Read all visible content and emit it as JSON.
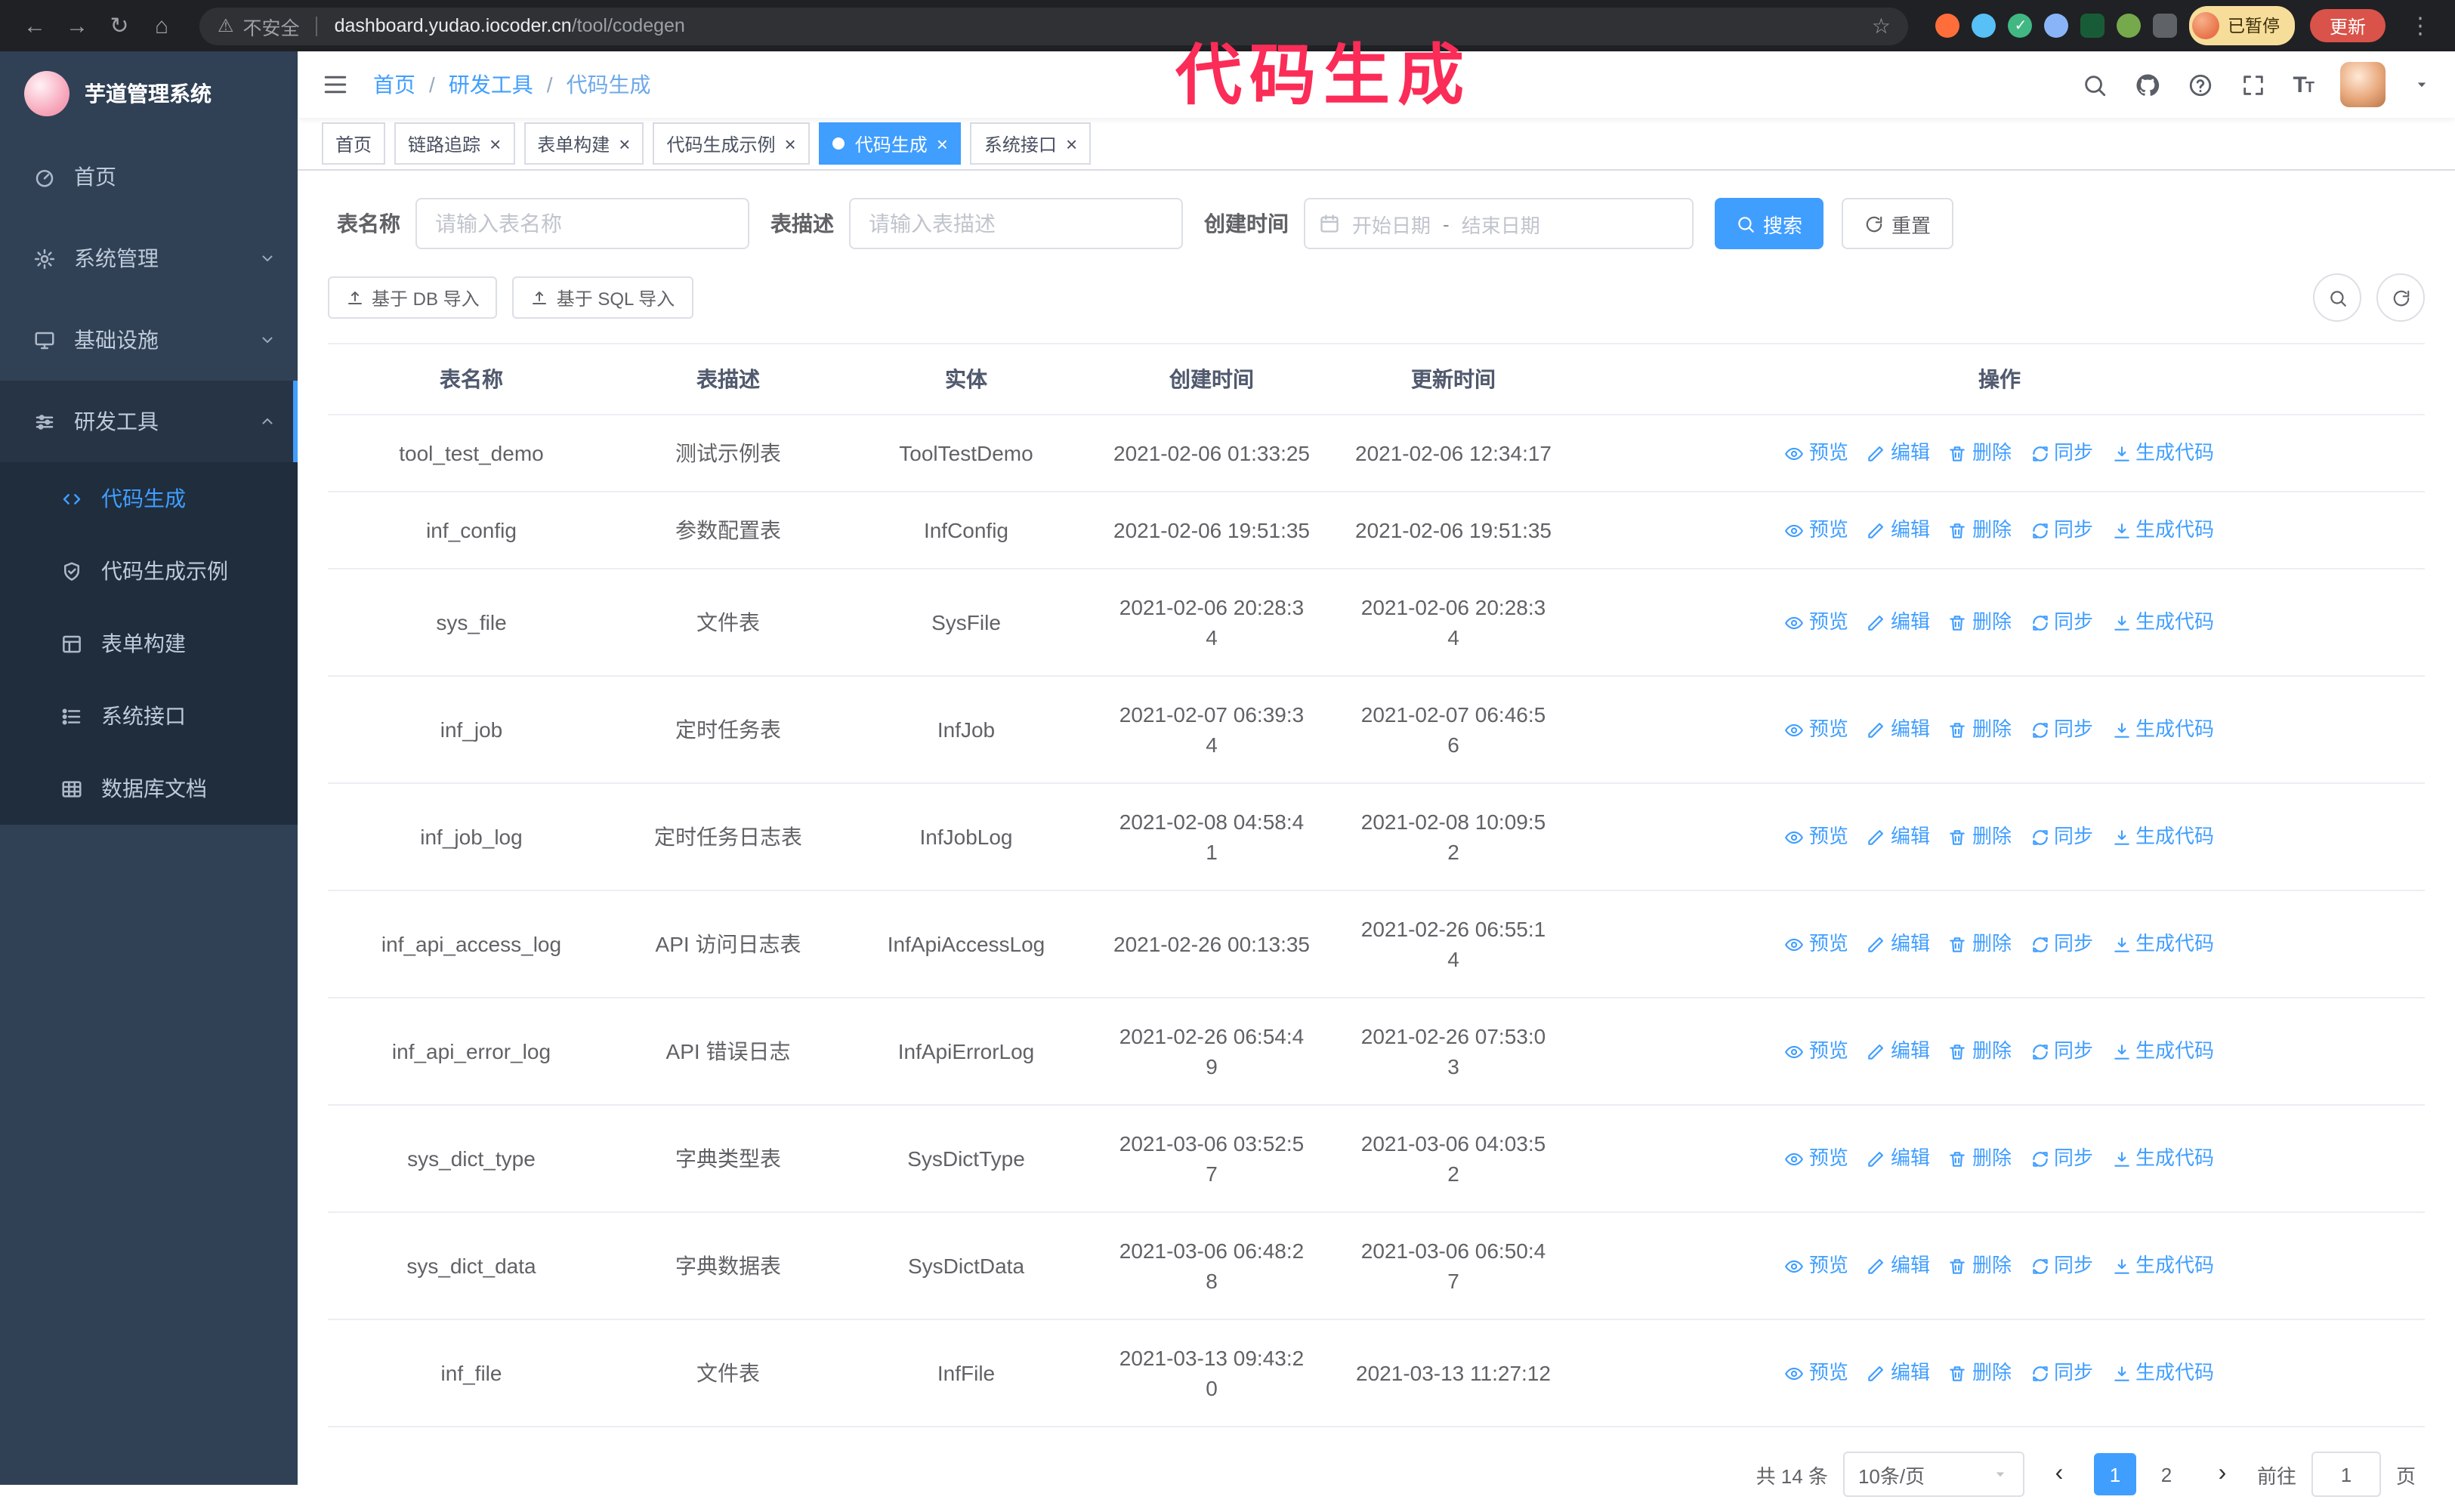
{
  "browser": {
    "security_warning": "不安全",
    "url_host": "dashboard.yudao.iocoder.cn",
    "url_path": "/tool/codegen",
    "paused_badge": "已暂停",
    "update_button": "更新"
  },
  "annotation": {
    "text": "代码生成",
    "color": "#fb2c57"
  },
  "sidebar": {
    "logo_title": "芋道管理系统",
    "items": [
      {
        "label": "首页",
        "expandable": false,
        "expanded": false
      },
      {
        "label": "系统管理",
        "expandable": true,
        "expanded": false
      },
      {
        "label": "基础设施",
        "expandable": true,
        "expanded": false
      },
      {
        "label": "研发工具",
        "expandable": true,
        "expanded": true
      }
    ],
    "sub_items": [
      {
        "label": "代码生成",
        "active": true
      },
      {
        "label": "代码生成示例",
        "active": false
      },
      {
        "label": "表单构建",
        "active": false
      },
      {
        "label": "系统接口",
        "active": false
      },
      {
        "label": "数据库文档",
        "active": false
      }
    ]
  },
  "header": {
    "breadcrumb": [
      "首页",
      "研发工具",
      "代码生成"
    ]
  },
  "tabs": [
    {
      "label": "首页",
      "closable": false,
      "active": false
    },
    {
      "label": "链路追踪",
      "closable": true,
      "active": false
    },
    {
      "label": "表单构建",
      "closable": true,
      "active": false
    },
    {
      "label": "代码生成示例",
      "closable": true,
      "active": false
    },
    {
      "label": "代码生成",
      "closable": true,
      "active": true
    },
    {
      "label": "系统接口",
      "closable": true,
      "active": false
    }
  ],
  "filters": {
    "table_name_label": "表名称",
    "table_name_placeholder": "请输入表名称",
    "table_desc_label": "表描述",
    "table_desc_placeholder": "请输入表描述",
    "create_time_label": "创建时间",
    "date_start_placeholder": "开始日期",
    "date_separator": "-",
    "date_end_placeholder": "结束日期",
    "search_button": "搜索",
    "reset_button": "重置"
  },
  "toolbar": {
    "import_db_button": "基于 DB 导入",
    "import_sql_button": "基于 SQL 导入"
  },
  "table": {
    "columns": [
      "表名称",
      "表描述",
      "实体",
      "创建时间",
      "更新时间",
      "操作"
    ],
    "row_actions": [
      "预览",
      "编辑",
      "删除",
      "同步",
      "生成代码"
    ],
    "rows": [
      [
        "tool_test_demo",
        "测试示例表",
        "ToolTestDemo",
        "2021-02-06 01:33:25",
        "2021-02-06 12:34:17"
      ],
      [
        "inf_config",
        "参数配置表",
        "InfConfig",
        "2021-02-06 19:51:35",
        "2021-02-06 19:51:35"
      ],
      [
        "sys_file",
        "文件表",
        "SysFile",
        "2021-02-06 20:28:3\n4",
        "2021-02-06 20:28:3\n4"
      ],
      [
        "inf_job",
        "定时任务表",
        "InfJob",
        "2021-02-07 06:39:3\n4",
        "2021-02-07 06:46:5\n6"
      ],
      [
        "inf_job_log",
        "定时任务日志表",
        "InfJobLog",
        "2021-02-08 04:58:4\n1",
        "2021-02-08 10:09:5\n2"
      ],
      [
        "inf_api_access_log",
        "API 访问日志表",
        "InfApiAccessLog",
        "2021-02-26 00:13:35",
        "2021-02-26 06:55:1\n4"
      ],
      [
        "inf_api_error_log",
        "API 错误日志",
        "InfApiErrorLog",
        "2021-02-26 06:54:4\n9",
        "2021-02-26 07:53:0\n3"
      ],
      [
        "sys_dict_type",
        "字典类型表",
        "SysDictType",
        "2021-03-06 03:52:5\n7",
        "2021-03-06 04:03:5\n2"
      ],
      [
        "sys_dict_data",
        "字典数据表",
        "SysDictData",
        "2021-03-06 06:48:2\n8",
        "2021-03-06 06:50:4\n7"
      ],
      [
        "inf_file",
        "文件表",
        "InfFile",
        "2021-03-13 09:43:2\n0",
        "2021-03-13 11:27:12"
      ]
    ]
  },
  "pagination": {
    "total_text": "共 14 条",
    "page_size": "10条/页",
    "pages": [
      "1",
      "2"
    ],
    "active_page": "1",
    "goto_label": "前往",
    "goto_value": "1",
    "goto_suffix": "页"
  },
  "colors": {
    "accent": "#409eff",
    "annotation": "#fb2c57",
    "sidebar_bg": "#304156",
    "submenu_bg": "#1f2d3d",
    "chrome_bg": "#202124",
    "update_button_bg": "#d9534a",
    "paused_badge_bg": "#f6dd9a"
  }
}
